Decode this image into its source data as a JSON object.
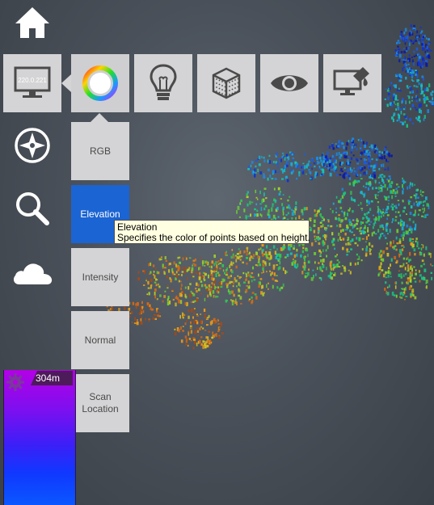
{
  "nav": {
    "items": [
      {
        "id": "home",
        "icon": "home-icon"
      },
      {
        "id": "compass",
        "icon": "compass-icon"
      },
      {
        "id": "search",
        "icon": "search-icon"
      },
      {
        "id": "cloud",
        "icon": "cloud-icon"
      }
    ]
  },
  "toolbar": {
    "items": [
      {
        "id": "display",
        "icon": "monitor-icon",
        "screen_text": "220.0.221"
      },
      {
        "id": "color",
        "icon": "color-wheel-icon",
        "active": true
      },
      {
        "id": "lighting",
        "icon": "lightbulb-icon"
      },
      {
        "id": "points",
        "icon": "point-cube-icon"
      },
      {
        "id": "visibility",
        "icon": "eye-icon"
      },
      {
        "id": "background",
        "icon": "paint-monitor-icon"
      }
    ]
  },
  "color_menu": {
    "options": [
      {
        "label": "RGB"
      },
      {
        "label": "Elevation",
        "selected": true
      },
      {
        "label": "Intensity"
      },
      {
        "label": "Normal"
      },
      {
        "label": "Scan Location"
      }
    ]
  },
  "tooltip": {
    "title": "Elevation",
    "text": "Specifies the color of points based on height."
  },
  "elevation_legend": {
    "max_label": "304m",
    "icon": "gear-icon"
  },
  "colors": {
    "selected": "#1b64d3",
    "panel": "#d4d4d6",
    "icon": "#4a4a4a",
    "tooltip_bg": "#ffffe1"
  }
}
